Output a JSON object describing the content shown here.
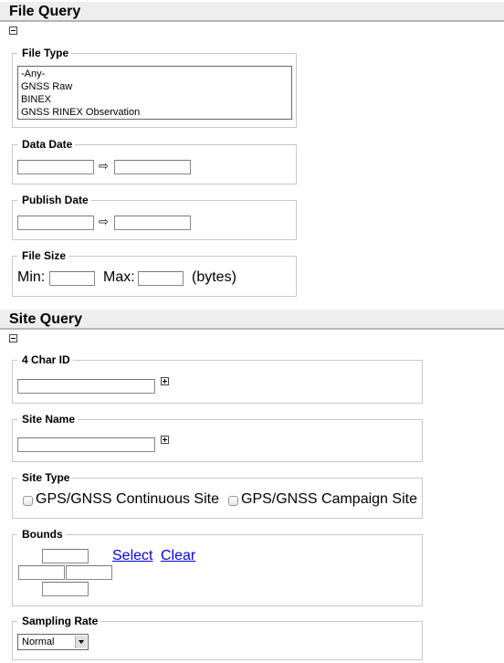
{
  "file_query": {
    "title": "File Query",
    "file_type": {
      "legend": "File Type",
      "options": [
        "-Any-",
        "GNSS Raw",
        "BINEX",
        "GNSS RINEX Observation"
      ]
    },
    "data_date": {
      "legend": "Data Date",
      "from_value": "",
      "to_value": "",
      "arrow": "⇨"
    },
    "publish_date": {
      "legend": "Publish Date",
      "from_value": "",
      "to_value": "",
      "arrow": "⇨"
    },
    "file_size": {
      "legend": "File Size",
      "min_label": "Min:",
      "max_label": "Max:",
      "unit_label": "(bytes)",
      "min_value": "",
      "max_value": ""
    }
  },
  "site_query": {
    "title": "Site Query",
    "char_id": {
      "legend": "4 Char ID",
      "value": ""
    },
    "site_name": {
      "legend": "Site Name",
      "value": ""
    },
    "site_type": {
      "legend": "Site Type",
      "options": [
        {
          "label": "GPS/GNSS Continuous Site",
          "checked": false
        },
        {
          "label": "GPS/GNSS Campaign Site",
          "checked": false
        }
      ]
    },
    "bounds": {
      "legend": "Bounds",
      "select_label": "Select",
      "clear_label": "Clear",
      "north": "",
      "west": "",
      "east": "",
      "south": ""
    },
    "sampling_rate": {
      "legend": "Sampling Rate",
      "selected": "Normal"
    }
  }
}
